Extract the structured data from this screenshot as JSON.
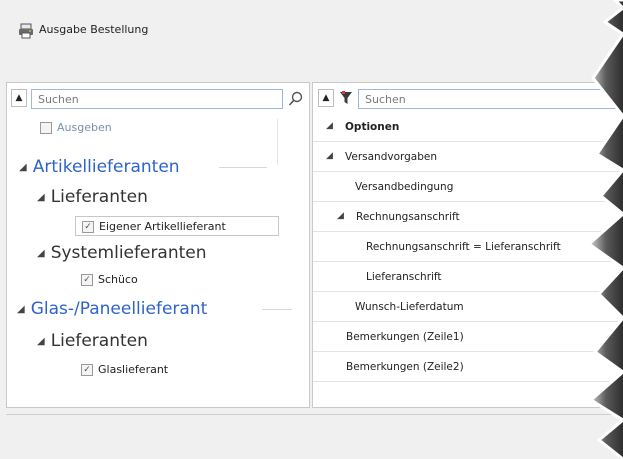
{
  "window": {
    "title": "Ausgabe Bestellung",
    "icon": "printer-icon"
  },
  "left_panel": {
    "search_placeholder": "Suchen",
    "collapse_symbol": "▲",
    "search_icon": "magnifier-icon",
    "ausgeben_label": "Ausgeben",
    "tree": {
      "artikellieferanten": "Artikellieferanten",
      "lieferanten_1": "Lieferanten",
      "eigener": "Eigener Artikellieferant",
      "systemlieferanten": "Systemlieferanten",
      "schueco": "Schüco",
      "glas": "Glas-/Paneellieferant",
      "lieferanten_2": "Lieferanten",
      "glaslieferant": "Glaslieferant"
    },
    "accent_color": "#2e63c9"
  },
  "right_panel": {
    "search_placeholder": "Suchen",
    "collapse_symbol": "▲",
    "filter_icon": "filter-icon",
    "rows": {
      "optionen": "Optionen",
      "versandvorgaben": "Versandvorgaben",
      "versandbedingung": "Versandbedingung",
      "rechnungsanschrift": "Rechnungsanschrift",
      "rechnung_eq": "Rechnungsanschrift = Lieferanschrift",
      "lieferanschrift": "Lieferanschrift",
      "wunsch": "Wunsch-Lieferdatum",
      "bem1": "Bemerkungen (Zeile1)",
      "bem2": "Bemerkungen (Zeile2)"
    }
  }
}
